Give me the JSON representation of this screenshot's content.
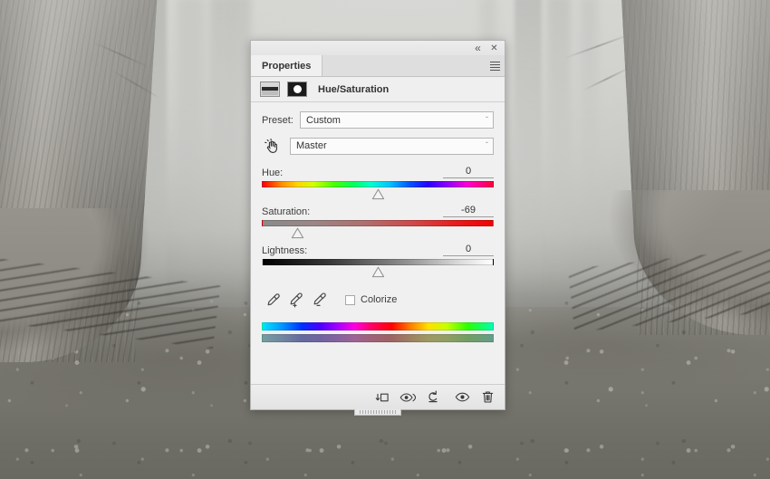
{
  "background": {
    "scene_description": "Foggy desaturated forest with two large tree trunks framing a misty path"
  },
  "panel": {
    "window_controls": {
      "collapse_icon": "double-chevron-left-icon",
      "collapse_glyph": "«",
      "close_icon": "close-icon",
      "close_glyph": "✕"
    },
    "tabs": [
      {
        "label": "Properties",
        "active": true
      }
    ],
    "menu_icon": "panel-menu-icon",
    "adjustment": {
      "thumbnail_icon": "adjustment-layer-thumbnail-icon",
      "mask_icon": "layer-mask-thumbnail-icon",
      "title": "Hue/Saturation"
    },
    "preset": {
      "label": "Preset:",
      "value": "Custom",
      "chevron": "ˇ"
    },
    "on_image_tool_icon": "on-image-adjustment-hand-icon",
    "channel": {
      "value": "Master",
      "chevron": "ˇ"
    },
    "sliders": [
      {
        "name": "Hue:",
        "value": "0",
        "position_pct": 50,
        "track": "hue"
      },
      {
        "name": "Saturation:",
        "value": "-69",
        "position_pct": 15.5,
        "track": "sat"
      },
      {
        "name": "Lightness:",
        "value": "0",
        "position_pct": 50,
        "track": "light"
      }
    ],
    "eyedroppers": [
      {
        "icon": "eyedropper-icon",
        "name": "sample-color"
      },
      {
        "icon": "eyedropper-plus-icon",
        "name": "add-to-sample"
      },
      {
        "icon": "eyedropper-minus-icon",
        "name": "subtract-from-sample"
      }
    ],
    "colorize": {
      "label": "Colorize",
      "checked": false
    },
    "range_bars": {
      "top_name": "source-hue-range-bar",
      "bottom_name": "result-hue-range-bar"
    },
    "footer_buttons": [
      {
        "name": "clip-to-layer-button",
        "icon": "clip-to-layer-icon",
        "title": "Clip to layer"
      },
      {
        "name": "view-previous-state-button",
        "icon": "eye-previous-state-icon",
        "title": "View previous state"
      },
      {
        "name": "reset-button",
        "icon": "reset-arrow-icon",
        "title": "Reset to adjustment defaults"
      },
      {
        "name": "toggle-visibility-button",
        "icon": "eye-icon",
        "title": "Toggle layer visibility"
      },
      {
        "name": "delete-button",
        "icon": "trash-icon",
        "title": "Delete this adjustment layer"
      }
    ],
    "resize_grip": "panel-resize-grip"
  },
  "colors": {
    "panel_bg": "#f0f0f0",
    "tab_active_bg": "#f0f0f0",
    "tabstrip_bg": "#dedede",
    "border": "#b4b4b4",
    "text": "#3c3c3c"
  }
}
